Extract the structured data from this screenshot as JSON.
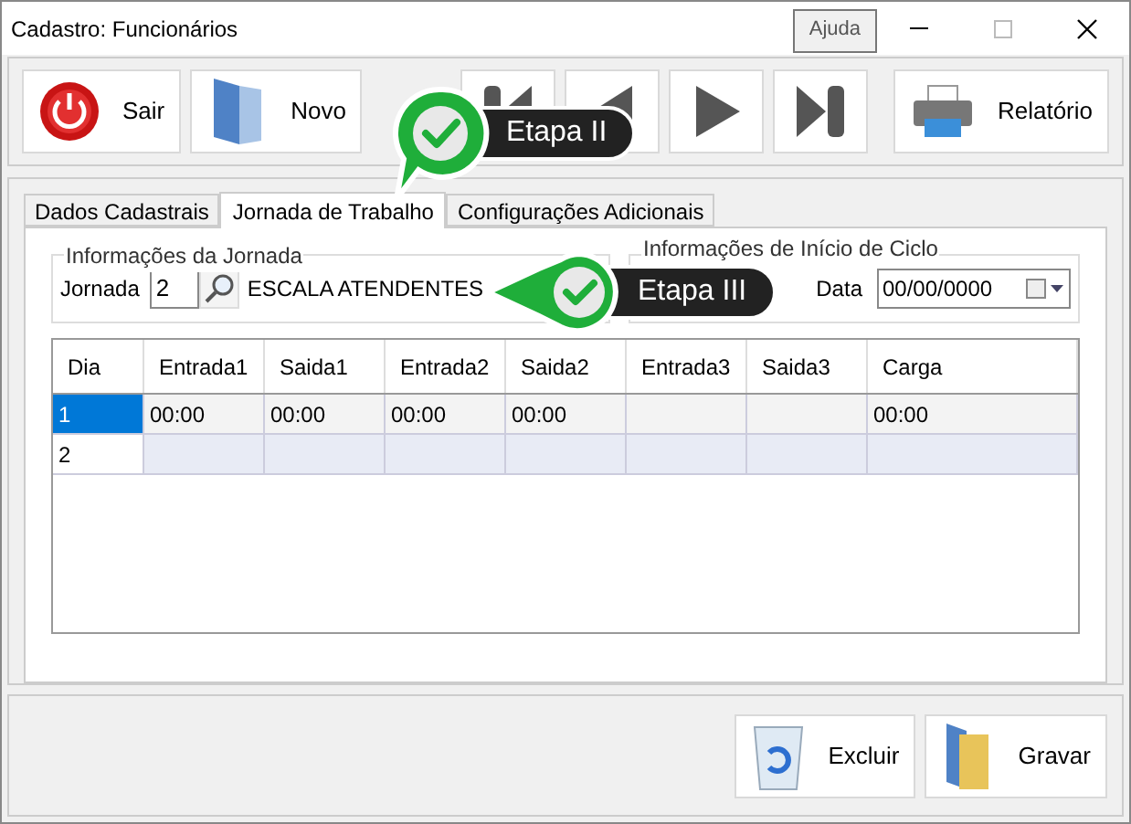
{
  "window": {
    "title": "Cadastro: Funcionários",
    "help_button": "Ajuda"
  },
  "toolbar": {
    "exit": "Sair",
    "new": "Novo",
    "report": "Relatório"
  },
  "tabs": [
    {
      "label": "Dados Cadastrais",
      "selected": false
    },
    {
      "label": "Jornada de Trabalho",
      "selected": true
    },
    {
      "label": "Configurações Adicionais",
      "selected": false
    }
  ],
  "jornada_group": {
    "title": "Informações da Jornada",
    "label": "Jornada",
    "value": "2",
    "name": "ESCALA ATENDENTES"
  },
  "ciclo_group": {
    "title": "Informações de Início de Ciclo",
    "date_label": "Data",
    "date_value": "00/00/0000"
  },
  "grid": {
    "columns": [
      "Dia",
      "Entrada1",
      "Saida1",
      "Entrada2",
      "Saida2",
      "Entrada3",
      "Saida3",
      "Carga"
    ],
    "rows": [
      {
        "dia": "1",
        "cells": [
          "00:00",
          "00:00",
          "00:00",
          "00:00",
          null,
          null,
          "00:00"
        ],
        "selected": true
      },
      {
        "dia": "2",
        "selected": false
      }
    ]
  },
  "callouts": [
    {
      "label": "Etapa II"
    },
    {
      "label": "Etapa III"
    }
  ],
  "bottom": {
    "delete": "Excluir",
    "save": "Gravar"
  }
}
